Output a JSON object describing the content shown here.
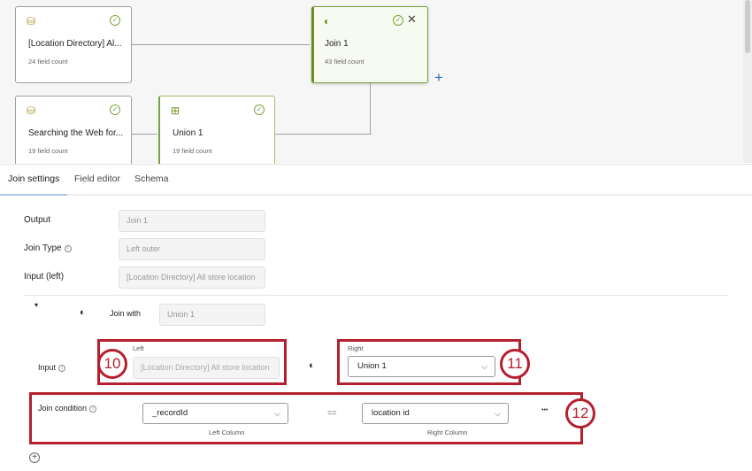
{
  "canvas": {
    "nodes": [
      {
        "title": "[Location Directory] Al...",
        "sub": "24 field count",
        "icon": "dataset-icon"
      },
      {
        "title": "Join 1",
        "sub": "43 field count",
        "icon": "join-icon"
      },
      {
        "title": "Searching the Web for...",
        "sub": "19 field count",
        "icon": "dataset-icon"
      },
      {
        "title": "Union 1",
        "sub": "19 field count",
        "icon": "union-icon"
      }
    ],
    "add": "+"
  },
  "tabs": [
    "Join settings",
    "Field editor",
    "Schema"
  ],
  "form": {
    "output_label": "Output",
    "output_value": "Join 1",
    "join_type_label": "Join Type",
    "join_type_value": "Left outer",
    "input_left_label": "Input (left)",
    "input_left_value": "[Location Directory] All store location",
    "join_with_label": "Join with",
    "join_with_value": "Union 1",
    "input_label": "Input",
    "left_label": "Left",
    "left_value": "[Location Directory] All store location",
    "right_label": "Right",
    "right_value": "Union 1",
    "join_condition_label": "Join condition",
    "left_column_value": "_recordId",
    "operator": "==",
    "right_column_value": "location id",
    "left_column_label": "Left Column",
    "right_column_label": "Right Column",
    "more": "•••"
  },
  "callouts": [
    "10",
    "11",
    "12"
  ],
  "colors": {
    "accent": "#7aa13b",
    "callout": "#b5202e",
    "tab_underline": "#a9c7e8"
  }
}
